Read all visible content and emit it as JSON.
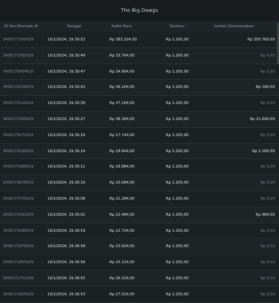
{
  "window": {
    "title": "The Big Dawgs"
  },
  "table": {
    "headers": {
      "id": "ID Sesi Bermain #",
      "date": "Tanggal",
      "balance": "Saldo Baru",
      "bet": "Taruhan",
      "win": "Jumlah Dimenangkan"
    },
    "rows": [
      {
        "id": "3458177200029",
        "date": "16/1/2024, 19.39.52",
        "balance": "Rp 383.324,00",
        "bet": "Rp 1.200,00",
        "win": "Rp 350.760,00",
        "win_positive": true
      },
      {
        "id": "3458171035029",
        "date": "16/1/2024, 19.39.49",
        "balance": "Rp 33.764,00",
        "bet": "Rp 1.200,00",
        "win": "Rp 0,00",
        "win_positive": false
      },
      {
        "id": "3458176864020",
        "date": "16/1/2024, 19.39.47",
        "balance": "Rp 34.964,00",
        "bet": "Rp 1.200,00",
        "win": "Rp 0,00",
        "win_positive": false
      },
      {
        "id": "3458176234029",
        "date": "16/1/2024, 19.39.42",
        "balance": "Rp 36.164,00",
        "bet": "Rp 1.200,00",
        "win": "Rp 180,00",
        "win_positive": true
      },
      {
        "id": "3458176120029",
        "date": "16/1/2024, 19.39.38",
        "balance": "Rp 37.184,00",
        "bet": "Rp 1.200,00",
        "win": "Rp 0,00",
        "win_positive": false
      },
      {
        "id": "3458175250029",
        "date": "16/1/2024, 19.39.27",
        "balance": "Rp 38.384,00",
        "bet": "Rp 1.200,00",
        "win": "Rp 21.840,00",
        "win_positive": true
      },
      {
        "id": "3458175072029",
        "date": "16/1/2024, 19.39.24",
        "balance": "Rp 17.744,00",
        "bet": "Rp 1.200,00",
        "win": "Rp 0,00",
        "win_positive": false
      },
      {
        "id": "3458174220029",
        "date": "16/1/2024, 19.39.14",
        "balance": "Rp 18.944,00",
        "bet": "Rp 1.200,00",
        "win": "Rp 1.260,00",
        "win_positive": true
      },
      {
        "id": "3458173988029",
        "date": "16/1/2024, 19.39.11",
        "balance": "Rp 18.884,00",
        "bet": "Rp 1.200,00",
        "win": "Rp 0,00",
        "win_positive": false
      },
      {
        "id": "3458173879029",
        "date": "16/1/2024, 19.39.10",
        "balance": "Rp 20.084,00",
        "bet": "Rp 1.200,00",
        "win": "Rp 0,00",
        "win_positive": false
      },
      {
        "id": "3458173755029",
        "date": "16/1/2024, 19.39.08",
        "balance": "Rp 21.284,00",
        "bet": "Rp 1.200,00",
        "win": "Rp 0,00",
        "win_positive": false
      },
      {
        "id": "3458173262029",
        "date": "16/1/2024, 19.39.01",
        "balance": "Rp 22.484,00",
        "bet": "Rp 1.200,00",
        "win": "Rp 960,00",
        "win_positive": true
      },
      {
        "id": "3458173090029",
        "date": "16/1/2024, 19.38.59",
        "balance": "Rp 22.724,00",
        "bet": "Rp 1.200,00",
        "win": "Rp 0,00",
        "win_positive": false
      },
      {
        "id": "3458172970029",
        "date": "16/1/2024, 19.38.58",
        "balance": "Rp 23.924,00",
        "bet": "Rp 1.200,00",
        "win": "Rp 0,00",
        "win_positive": false
      },
      {
        "id": "3458172853029",
        "date": "16/1/2024, 19.38.56",
        "balance": "Rp 25.124,00",
        "bet": "Rp 1.200,00",
        "win": "Rp 0,00",
        "win_positive": false
      },
      {
        "id": "3458172731029",
        "date": "16/1/2024, 19.38.55",
        "balance": "Rp 26.324,00",
        "bet": "Rp 1.200,00",
        "win": "Rp 0,00",
        "win_positive": false
      },
      {
        "id": "3458172604029",
        "date": "16/1/2024, 19.38.53",
        "balance": "Rp 27.524,00",
        "bet": "Rp 1.200,00",
        "win": "Rp 0,00",
        "win_positive": false
      }
    ]
  },
  "colors": {
    "background": "#1c2124",
    "text": "#e7eaec",
    "muted": "#7b8287"
  }
}
